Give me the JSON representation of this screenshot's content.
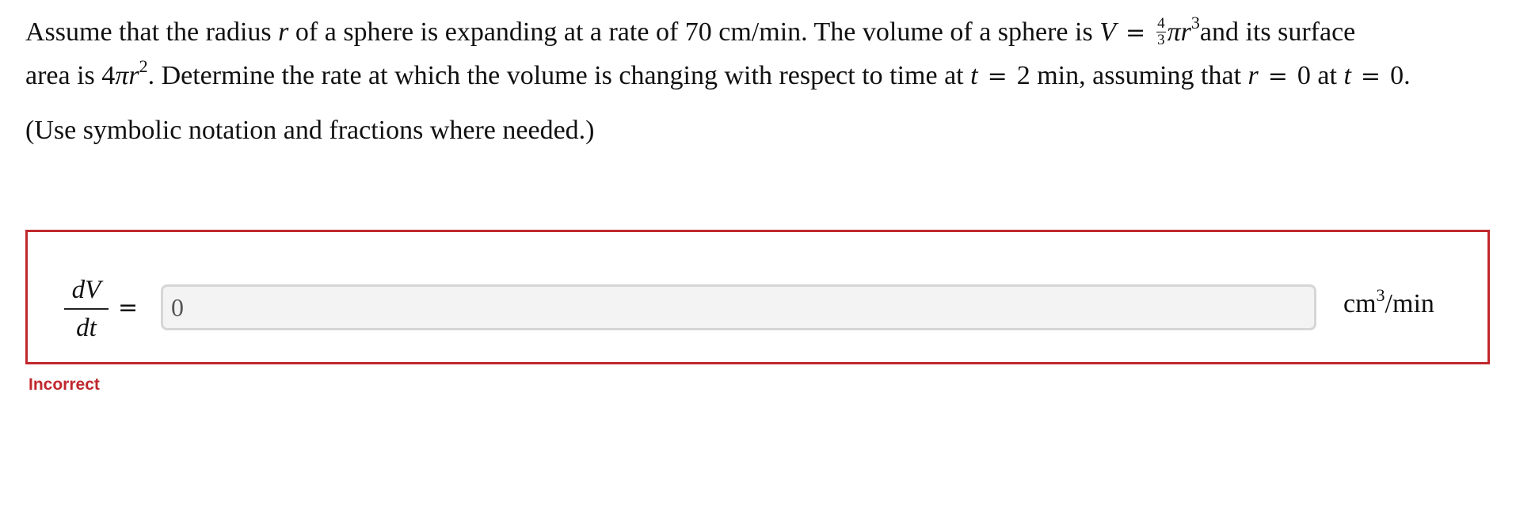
{
  "question": {
    "line1": {
      "p1": "Assume that the radius ",
      "var_r": "r",
      "p2": " of a sphere is expanding at a rate of 70 cm/min. The volume of a sphere is ",
      "var_V": "V",
      "eq": "=",
      "frac_num": "4",
      "frac_den": "3",
      "pi": "π",
      "r2": "r",
      "exp3": "3",
      "p3": "and its surface"
    },
    "line2": {
      "p1": "area is 4",
      "pi": "π",
      "r": "r",
      "exp2": "2",
      "p2": ". Determine the rate at which the volume is changing with respect to time at ",
      "t1": "t",
      "eq1": "=",
      "p3": "2 min, assuming that ",
      "r2": "r",
      "eq2": "=",
      "p4": "0 at ",
      "t2": "t",
      "eq3": "=",
      "p5": "0."
    },
    "hint": "(Use symbolic notation and fractions where needed.)"
  },
  "answer": {
    "lhs_num": "dV",
    "lhs_den": "dt",
    "equals": "=",
    "value": "0",
    "units_base": "cm",
    "units_exp": "3",
    "units_tail": "/min"
  },
  "feedback": {
    "text": "Incorrect",
    "color": "#c0282d"
  }
}
